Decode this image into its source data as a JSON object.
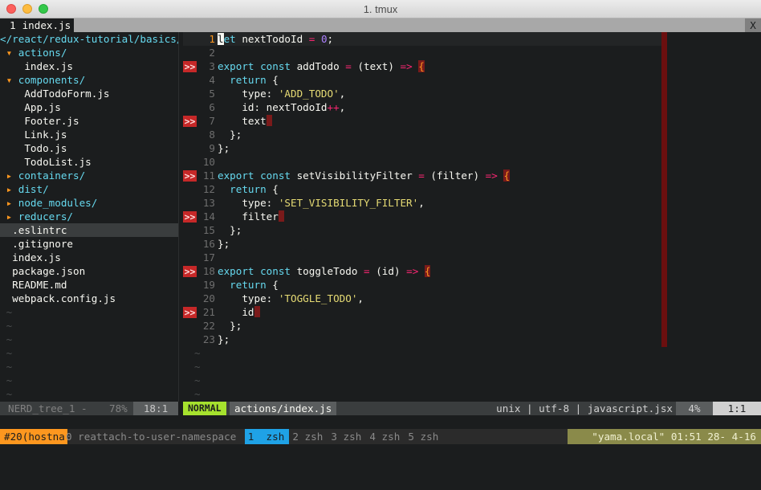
{
  "window": {
    "title": "1. tmux"
  },
  "tabline": {
    "tab_number": "1",
    "tab_label": "index.js",
    "close_label": "X"
  },
  "nerdtree": {
    "root": "</react/redux-tutorial/basics/",
    "rows": [
      {
        "kind": "dir-open",
        "arrow": "▾",
        "label": "actions/",
        "indent": 0
      },
      {
        "kind": "file",
        "label": "index.js",
        "indent": 2
      },
      {
        "kind": "dir-open",
        "arrow": "▾",
        "label": "components/",
        "indent": 0
      },
      {
        "kind": "file",
        "label": "AddTodoForm.js",
        "indent": 2
      },
      {
        "kind": "file",
        "label": "App.js",
        "indent": 2
      },
      {
        "kind": "file",
        "label": "Footer.js",
        "indent": 2
      },
      {
        "kind": "file",
        "label": "Link.js",
        "indent": 2
      },
      {
        "kind": "file",
        "label": "Todo.js",
        "indent": 2
      },
      {
        "kind": "file",
        "label": "TodoList.js",
        "indent": 2
      },
      {
        "kind": "dir-closed",
        "arrow": "▸",
        "label": "containers/",
        "indent": 0
      },
      {
        "kind": "dir-closed",
        "arrow": "▸",
        "label": "dist/",
        "indent": 0
      },
      {
        "kind": "dir-closed",
        "arrow": "▸",
        "label": "node_modules/",
        "indent": 0
      },
      {
        "kind": "dir-closed",
        "arrow": "▸",
        "label": "reducers/",
        "indent": 0
      },
      {
        "kind": "file",
        "label": ".eslintrc",
        "indent": 0,
        "selected": true
      },
      {
        "kind": "file",
        "label": ".gitignore",
        "indent": 0
      },
      {
        "kind": "file",
        "label": "index.js",
        "indent": 0
      },
      {
        "kind": "file",
        "label": "package.json",
        "indent": 0
      },
      {
        "kind": "file",
        "label": "README.md",
        "indent": 0
      },
      {
        "kind": "file",
        "label": "webpack.config.js",
        "indent": 0
      }
    ],
    "tilde": "~",
    "tilde_count": 7
  },
  "editor": {
    "sign_text": ">>",
    "lines": [
      {
        "n": "1",
        "sign": false,
        "cursor": true,
        "tokens": [
          [
            "cursor",
            "l"
          ],
          [
            "kw",
            "et"
          ],
          [
            "ident",
            " nextTodoId "
          ],
          [
            "op",
            "="
          ],
          [
            "ident",
            " "
          ],
          [
            "num",
            "0"
          ],
          [
            "ident",
            ";"
          ]
        ]
      },
      {
        "n": "2",
        "sign": false,
        "tokens": []
      },
      {
        "n": "3",
        "sign": true,
        "tokens": [
          [
            "kw",
            "export"
          ],
          [
            "ident",
            " "
          ],
          [
            "kw",
            "const"
          ],
          [
            "ident",
            " addTodo "
          ],
          [
            "op",
            "="
          ],
          [
            "ident",
            " (text) "
          ],
          [
            "op",
            "=>"
          ],
          [
            "ident",
            " "
          ],
          [
            "brace",
            "{"
          ]
        ]
      },
      {
        "n": "4",
        "sign": false,
        "tokens": [
          [
            "ident",
            "  "
          ],
          [
            "kw",
            "return"
          ],
          [
            "ident",
            " {"
          ]
        ]
      },
      {
        "n": "5",
        "sign": false,
        "tokens": [
          [
            "ident",
            "    type: "
          ],
          [
            "str",
            "'ADD_TODO'"
          ],
          [
            "ident",
            ","
          ]
        ]
      },
      {
        "n": "6",
        "sign": false,
        "tokens": [
          [
            "ident",
            "    id: nextTodoId"
          ],
          [
            "op",
            "++"
          ],
          [
            "ident",
            ","
          ]
        ]
      },
      {
        "n": "7",
        "sign": true,
        "tokens": [
          [
            "ident",
            "    text"
          ],
          [
            "trail",
            ""
          ]
        ]
      },
      {
        "n": "8",
        "sign": false,
        "tokens": [
          [
            "ident",
            "  };"
          ]
        ]
      },
      {
        "n": "9",
        "sign": false,
        "tokens": [
          [
            "ident",
            "};"
          ]
        ]
      },
      {
        "n": "10",
        "sign": false,
        "tokens": []
      },
      {
        "n": "11",
        "sign": true,
        "tokens": [
          [
            "kw",
            "export"
          ],
          [
            "ident",
            " "
          ],
          [
            "kw",
            "const"
          ],
          [
            "ident",
            " setVisibilityFilter "
          ],
          [
            "op",
            "="
          ],
          [
            "ident",
            " (filter) "
          ],
          [
            "op",
            "=>"
          ],
          [
            "ident",
            " "
          ],
          [
            "brace",
            "{"
          ]
        ]
      },
      {
        "n": "12",
        "sign": false,
        "tokens": [
          [
            "ident",
            "  "
          ],
          [
            "kw",
            "return"
          ],
          [
            "ident",
            " {"
          ]
        ]
      },
      {
        "n": "13",
        "sign": false,
        "tokens": [
          [
            "ident",
            "    type: "
          ],
          [
            "str",
            "'SET_VISIBILITY_FILTER'"
          ],
          [
            "ident",
            ","
          ]
        ]
      },
      {
        "n": "14",
        "sign": true,
        "tokens": [
          [
            "ident",
            "    filter"
          ],
          [
            "trail",
            ""
          ]
        ]
      },
      {
        "n": "15",
        "sign": false,
        "tokens": [
          [
            "ident",
            "  };"
          ]
        ]
      },
      {
        "n": "16",
        "sign": false,
        "tokens": [
          [
            "ident",
            "};"
          ]
        ]
      },
      {
        "n": "17",
        "sign": false,
        "tokens": []
      },
      {
        "n": "18",
        "sign": true,
        "tokens": [
          [
            "kw",
            "export"
          ],
          [
            "ident",
            " "
          ],
          [
            "kw",
            "const"
          ],
          [
            "ident",
            " toggleTodo "
          ],
          [
            "op",
            "="
          ],
          [
            "ident",
            " (id) "
          ],
          [
            "op",
            "=>"
          ],
          [
            "ident",
            " "
          ],
          [
            "brace",
            "{"
          ]
        ]
      },
      {
        "n": "19",
        "sign": false,
        "tokens": [
          [
            "ident",
            "  "
          ],
          [
            "kw",
            "return"
          ],
          [
            "ident",
            " {"
          ]
        ]
      },
      {
        "n": "20",
        "sign": false,
        "tokens": [
          [
            "ident",
            "    type: "
          ],
          [
            "str",
            "'TOGGLE_TODO'"
          ],
          [
            "ident",
            ","
          ]
        ]
      },
      {
        "n": "21",
        "sign": true,
        "tokens": [
          [
            "ident",
            "    id"
          ],
          [
            "trail",
            ""
          ]
        ]
      },
      {
        "n": "22",
        "sign": false,
        "tokens": [
          [
            "ident",
            "  };"
          ]
        ]
      },
      {
        "n": "23",
        "sign": false,
        "tokens": [
          [
            "ident",
            "};"
          ]
        ]
      }
    ],
    "tilde": "~",
    "tilde_count": 4
  },
  "status_left": {
    "name": "NERD_tree_1 -",
    "percent": "78%",
    "position": "18:1"
  },
  "status_right": {
    "mode": "NORMAL",
    "file": "actions/index.js",
    "fileinfo": "unix | utf-8 | javascript.jsx",
    "percent": "4%",
    "position": "1:1"
  },
  "tmux": {
    "session": "#20(hostna",
    "windows": [
      {
        "label": "0 reattach-to-user-namespace",
        "active": false
      },
      {
        "label": "1  zsh",
        "active": true
      },
      {
        "label": "2 zsh",
        "active": false
      },
      {
        "label": "3 zsh",
        "active": false
      },
      {
        "label": "4 zsh",
        "active": false
      },
      {
        "label": "5 zsh",
        "active": false
      }
    ],
    "right": "\"yama.local\" 01:51 28- 4-16"
  },
  "colors": {
    "mode_bg": "#a6e22e",
    "sign_bg": "#c62828",
    "tmux_session_bg": "#fd971f",
    "tmux_active_bg": "#1fa2e6"
  }
}
